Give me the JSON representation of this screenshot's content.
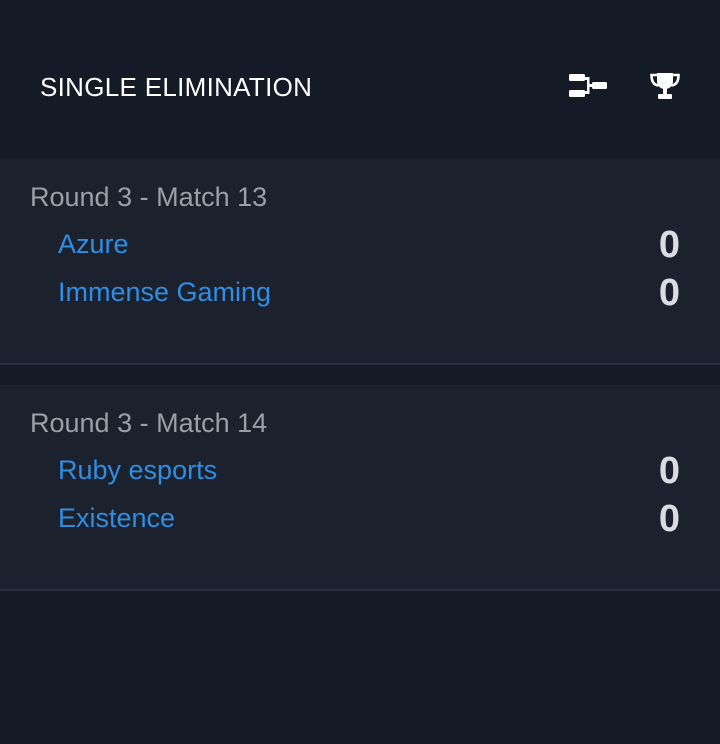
{
  "header": {
    "title": "SINGLE ELIMINATION",
    "icons": [
      "bracket-icon",
      "trophy-icon"
    ]
  },
  "matches": [
    {
      "round_label": "Round 3 - Match 13",
      "teams": [
        {
          "name": "Azure",
          "score": "0"
        },
        {
          "name": "Immense Gaming",
          "score": "0"
        }
      ]
    },
    {
      "round_label": "Round 3 - Match 14",
      "teams": [
        {
          "name": "Ruby esports",
          "score": "0"
        },
        {
          "name": "Existence",
          "score": "0"
        }
      ]
    }
  ],
  "colors": {
    "background": "#151b26",
    "card": "#1c222d",
    "team_link": "#2f8de4",
    "round_label": "#9aa0a8",
    "score": "#d9dde2"
  }
}
